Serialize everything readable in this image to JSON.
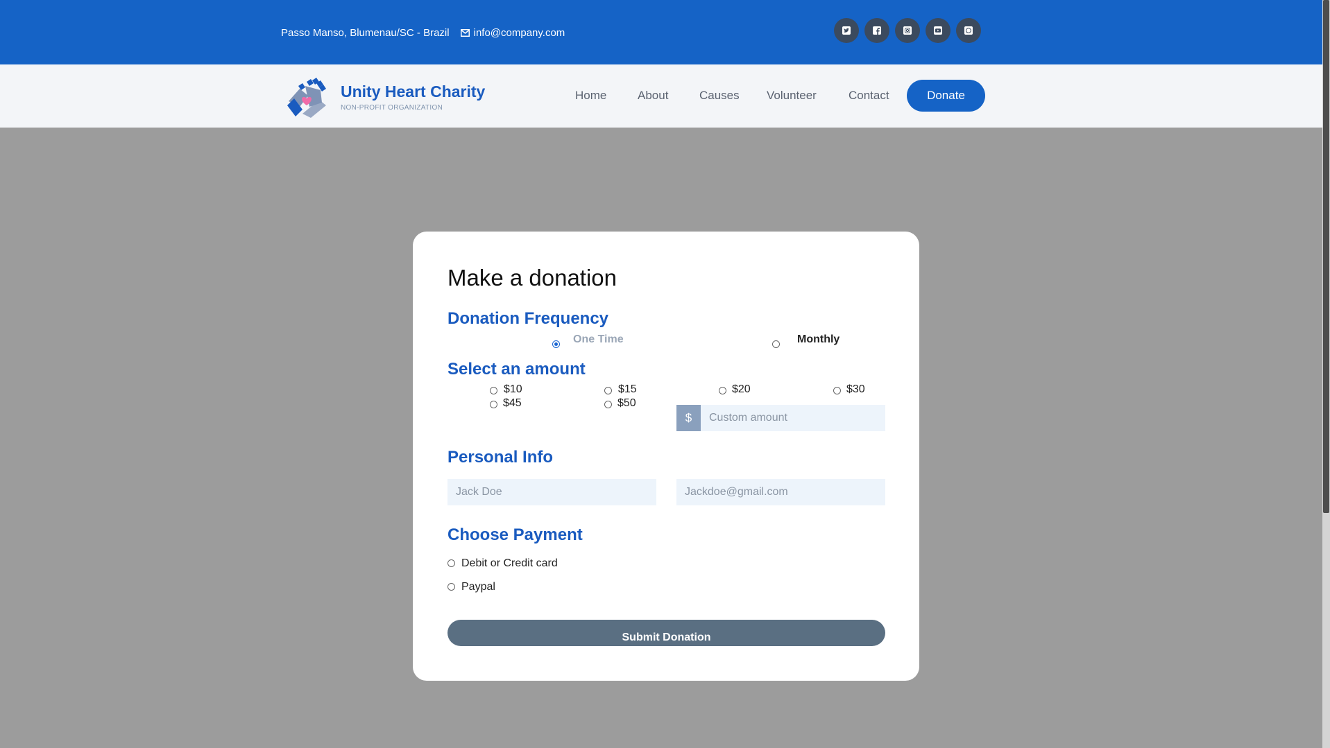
{
  "topbar": {
    "address": "Passo Manso, Blumenau/SC - Brazil",
    "email": "info@company.com",
    "socials": [
      {
        "icon": "twitter-icon"
      },
      {
        "icon": "facebook-icon"
      },
      {
        "icon": "instagram-icon"
      },
      {
        "icon": "youtube-icon"
      },
      {
        "icon": "whatsapp-icon"
      }
    ]
  },
  "brand": {
    "name": "Unity Heart Charity",
    "tagline": "NON-PROFIT ORGANIZATION",
    "logo_icon": "hands-heart-logo",
    "colors": {
      "primary": "#1563c6",
      "heart": "#f06ca8",
      "hands": "#7f93b6"
    }
  },
  "nav": {
    "items": [
      "Home",
      "About",
      "Causes",
      "Volunteer",
      "Contact"
    ],
    "donate_label": "Donate"
  },
  "form": {
    "title": "Make a donation",
    "frequency": {
      "title": "Donation Frequency",
      "options": [
        "One Time",
        "Monthly"
      ],
      "selected": "One Time"
    },
    "amount": {
      "title": "Select an amount",
      "options": [
        "$10",
        "$15",
        "$20",
        "$30",
        "$45",
        "$50"
      ],
      "currency_symbol": "$",
      "custom_placeholder": "Custom amount"
    },
    "personal": {
      "title": "Personal Info",
      "name_placeholder": "Jack Doe",
      "email_placeholder": "Jackdoe@gmail.com"
    },
    "payment": {
      "title": "Choose Payment",
      "options": [
        "Debit or Credit card",
        "Paypal"
      ]
    },
    "submit_label": "Submit Donation"
  }
}
